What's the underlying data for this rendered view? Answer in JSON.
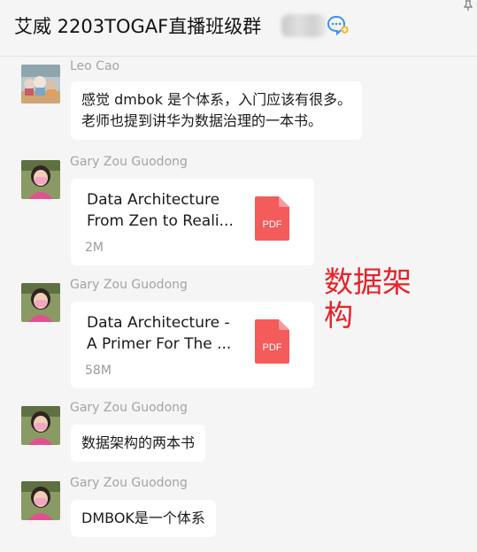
{
  "header": {
    "title": "艾威 2203TOGAF直播班级群",
    "group_icon": "chat-bubble-plus-icon",
    "pin_icon": "pin-icon"
  },
  "messages": [
    {
      "sender": "Leo Cao",
      "type": "text",
      "lines": [
        "感觉 dmbok 是个体系，入门应该有很多。",
        "老师也提到讲华为数据治理的一本书。"
      ]
    },
    {
      "sender": "Gary Zou Guodong",
      "type": "file",
      "file_name_lines": [
        "Data Architecture",
        "From Zen to Reali..."
      ],
      "file_size": "2M",
      "file_icon_label": "PDF"
    },
    {
      "sender": "Gary Zou Guodong",
      "type": "file",
      "file_name_lines": [
        "Data Architecture -",
        "A Primer For The ..."
      ],
      "file_size": "58M",
      "file_icon_label": "PDF"
    },
    {
      "sender": "Gary Zou Guodong",
      "type": "text",
      "lines": [
        "数据架构的两本书"
      ]
    },
    {
      "sender": "Gary Zou Guodong",
      "type": "text",
      "lines": [
        "DMBOK是一个体系"
      ]
    }
  ],
  "annotation": {
    "lines": [
      "数据架",
      "构"
    ],
    "color": "#e8212a"
  },
  "colors": {
    "pdf_red": "#f45b5b",
    "sender_gray": "#a4a4a4",
    "bubble": "#ffffff",
    "background": "#f5f5f5"
  }
}
